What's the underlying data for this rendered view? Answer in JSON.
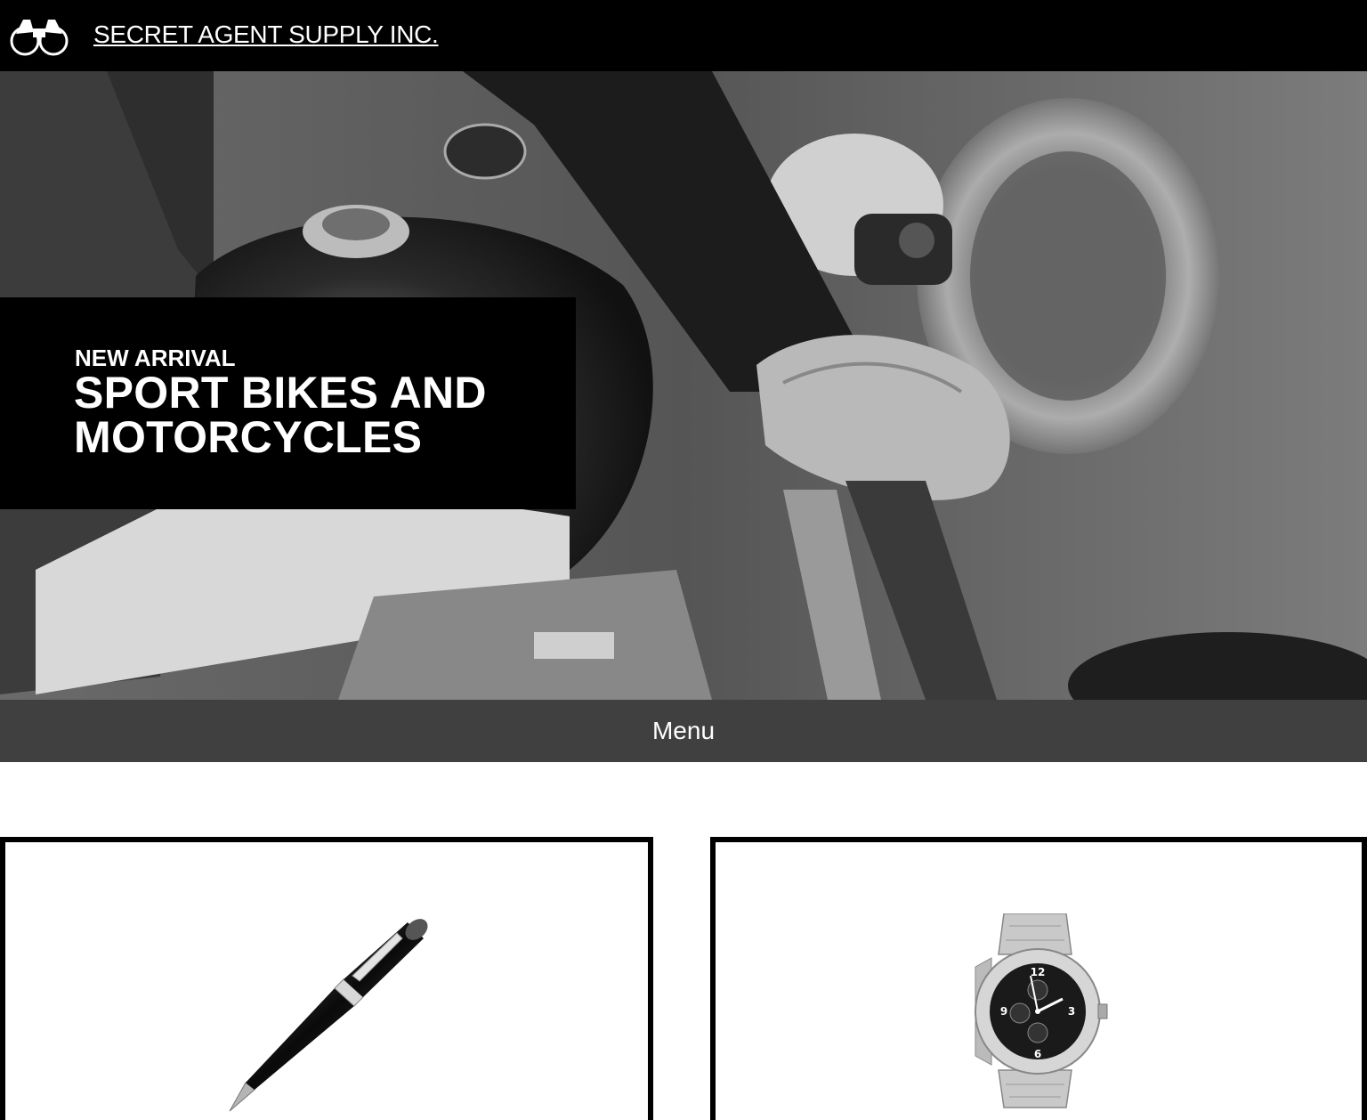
{
  "header": {
    "brand": "SECRET AGENT SUPPLY INC.",
    "logo_icon": "binoculars-icon"
  },
  "hero": {
    "kicker": "NEW ARRIVAL",
    "title": "SPORT BIKES AND MOTORCYCLES",
    "image": "motorcycle-rider-photo"
  },
  "nav": {
    "menu_label": "Menu"
  },
  "products": [
    {
      "image": "fountain-pen-photo"
    },
    {
      "image": "wristwatch-photo"
    }
  ],
  "colors": {
    "header_bg": "#000000",
    "menu_bg": "#404040",
    "text": "#ffffff"
  }
}
